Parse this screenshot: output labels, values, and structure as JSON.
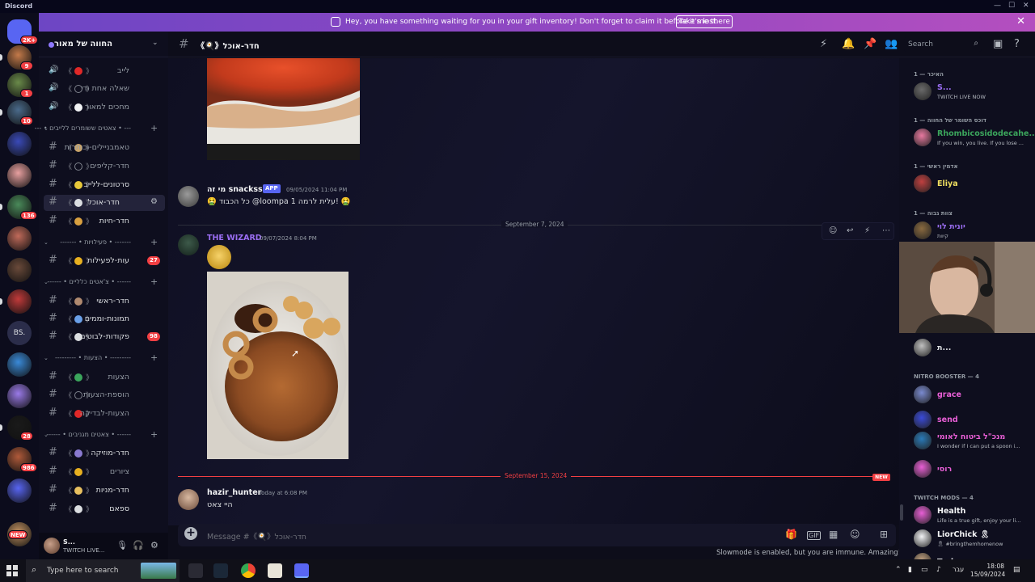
{
  "window": {
    "app_name": "Discord"
  },
  "banner": {
    "message": "Hey, you have something waiting for you in your gift inventory! Don't forget to claim it before it's lost.",
    "button": "Take me there",
    "close": "✕"
  },
  "servers": [
    {
      "badge": "2K+"
    },
    {
      "badge": "9"
    },
    {
      "badge": "1"
    },
    {
      "badge": "10"
    },
    {
      "badge": ""
    },
    {
      "badge": ""
    },
    {
      "badge": "136"
    },
    {
      "badge": ""
    },
    {
      "badge": ""
    },
    {
      "badge": ""
    },
    {
      "badge": "BS."
    },
    {
      "badge": ""
    },
    {
      "badge": ""
    },
    {
      "badge": "28"
    },
    {
      "badge": "986"
    },
    {
      "badge": ""
    },
    {
      "badge": "NEW"
    }
  ],
  "guild": {
    "name": "החווה של מאור"
  },
  "channels": [
    {
      "kind": "voice",
      "name": "לייב",
      "emoji_color": "#e02828"
    },
    {
      "kind": "voice",
      "name": "שאלה אחת ודי",
      "emoji_color": ""
    },
    {
      "kind": "voice",
      "name": "מחכים למאור",
      "emoji_color": "#f2f3f5"
    },
    {
      "kind": "category",
      "name": "--- • צאטים ששומרים ללייבים • ---"
    },
    {
      "kind": "text",
      "name": "טאמבניילים-וכותרות",
      "emoji_color": "#c9a46a"
    },
    {
      "kind": "text",
      "name": "חדר-קליפים",
      "emoji_color": ""
    },
    {
      "kind": "text",
      "name": "סרטונים-ללייב",
      "emoji_color": "#e8c83a",
      "bright": true
    },
    {
      "kind": "text",
      "name": "חדר-אוכל",
      "emoji_color": "#dbdee1",
      "active": true,
      "bright": true
    },
    {
      "kind": "text",
      "name": "חדר-חיות",
      "emoji_color": "#d9a040",
      "bright": true
    },
    {
      "kind": "category",
      "name": "------- • פעילויות • -------"
    },
    {
      "kind": "text",
      "name": "עות-לפעילות",
      "emoji_color": "#e8b020",
      "badge": "27",
      "bright": true
    },
    {
      "kind": "category",
      "name": "------ • צ'אטים כלליים • ------"
    },
    {
      "kind": "text",
      "name": "חדר-ראשי",
      "emoji_color": "#b08a70",
      "bright": true
    },
    {
      "kind": "text",
      "name": "תמונות-וממים",
      "emoji_color": "#6aa0e8",
      "bright": true
    },
    {
      "kind": "text",
      "name": "פקודות-לבוטים",
      "emoji_color": "#dbdee1",
      "badge": "98",
      "bright": true
    },
    {
      "kind": "category",
      "name": "--------- • הצעות • ---------"
    },
    {
      "kind": "text",
      "name": "הצעות",
      "emoji_color": "#3ba55c"
    },
    {
      "kind": "text",
      "name": "הוספת-הצעות",
      "emoji_color": ""
    },
    {
      "kind": "text",
      "name": "הצעות-לבדיקה",
      "emoji_color": "#e02828"
    },
    {
      "kind": "category",
      "name": "------ • צאטים מגניבים • ------"
    },
    {
      "kind": "text",
      "name": "חדר-מוזיקה",
      "emoji_color": "#8a7ad0",
      "bright": true
    },
    {
      "kind": "text",
      "name": "ציורים",
      "emoji_color": "#e8b020"
    },
    {
      "kind": "text",
      "name": "חדר-מניות",
      "emoji_color": "#e8c060",
      "bright": true
    },
    {
      "kind": "text",
      "name": "ספאם",
      "emoji_color": "#dbdee1",
      "bright": true
    }
  ],
  "user": {
    "name": "S...",
    "status": "TWITCH LIVE..."
  },
  "topbar": {
    "channel": "《🍳》חדר-אוכל",
    "search_placeholder": "Search"
  },
  "messages": [
    {
      "author": "מי זה snacksss",
      "tag": "APP",
      "time": "09/05/2024 11:04 PM",
      "text": "🤮 כל הכבוד @loompa עלית לרמה 1! 🤮",
      "author_color": "#f2f3f5"
    },
    {
      "author": "THE WIZARD",
      "time": "09/07/2024 8:04 PM",
      "author_color": "#9b6ef3"
    },
    {
      "author": "hazir_hunter",
      "time": "Today at 6:08 PM",
      "text": "היי צאט",
      "author_color": "#f2f3f5"
    }
  ],
  "dividers": {
    "first": "September 7, 2024",
    "second": "September 15, 2024",
    "new_tag": "NEW"
  },
  "input": {
    "placeholder": "Message #《🍳》חדר-אוכל"
  },
  "slowmode": "Slowmode is enabled, but you are immune. Amazing! 😊",
  "member_sections": [
    {
      "label": "האיכר — 1"
    },
    {
      "label": "דוכס השומר של החווה — 1"
    },
    {
      "label": "אדמין ראשי — 1"
    },
    {
      "label": "צוות גבוה — 1"
    },
    {
      "label": "NITRO BOOSTER — 4"
    },
    {
      "label": "TWITCH MODS — 4"
    }
  ],
  "members": [
    {
      "name": "S...",
      "status": "TWITCH LIVE NOW",
      "color": "#9b6ef3"
    },
    {
      "name": "Rhombicosidodecahe...",
      "status": "If you win, you live. If you lose ...",
      "color": "#3ba55c"
    },
    {
      "name": "Eliya",
      "status": "",
      "color": "#f0e060"
    },
    {
      "name": "יונית לוי",
      "status": "קיוות",
      "color": "#9b6ef3"
    },
    {
      "name": "ת...",
      "status": "",
      "color": "#dbdee1"
    },
    {
      "name": "grace",
      "status": "",
      "color": "#e85fd6"
    },
    {
      "name": "send",
      "status": "",
      "color": "#e85fd6"
    },
    {
      "name": "מנכ\"ל ביטוח לאומי",
      "status": "I wonder if I can put a spoon i...",
      "color": "#e85fd6"
    },
    {
      "name": "רוסי",
      "status": "",
      "color": "#e85fd6"
    },
    {
      "name": "Health",
      "status": "Life is a true gift, enjoy your li...",
      "color": "#f2f3f5"
    },
    {
      "name": "LiorChick 🎗",
      "status": "🎗 #bringthemhomenow",
      "color": "#f2f3f5"
    },
    {
      "name": "Turkey",
      "status": "",
      "color": "#f2f3f5"
    }
  ],
  "taskbar": {
    "search_placeholder": "Type here to search",
    "time": "18:08",
    "date": "15/09/2024",
    "lang": "עבר"
  },
  "colors": {
    "accent": "#5865f2",
    "banner_start": "#6d46c4",
    "banner_end": "#b44fbf",
    "danger": "#f23f43"
  }
}
